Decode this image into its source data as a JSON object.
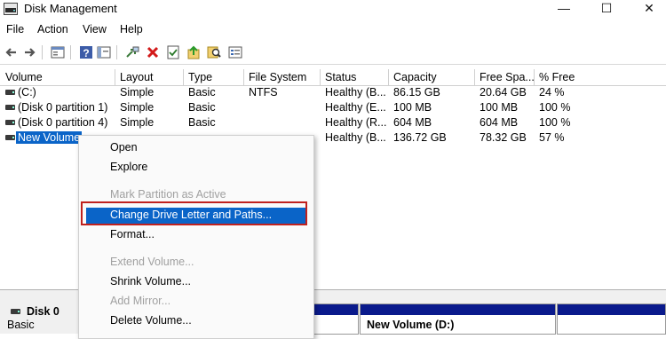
{
  "window": {
    "title": "Disk Management",
    "minimize": "—",
    "maximize": "☐",
    "close": "✕"
  },
  "menu": [
    "File",
    "Action",
    "View",
    "Help"
  ],
  "toolbar_icons": [
    "back-arrow-icon",
    "forward-arrow-icon",
    "properties-icon",
    "help-icon",
    "console-icon",
    "connect-icon",
    "delete-icon",
    "checkmark-icon",
    "up-arrow-icon",
    "search-icon",
    "list-icon"
  ],
  "columns": [
    "Volume",
    "Layout",
    "Type",
    "File System",
    "Status",
    "Capacity",
    "Free Spa...",
    "% Free"
  ],
  "rows": [
    [
      "(C:)",
      "Simple",
      "Basic",
      "NTFS",
      "Healthy (B...",
      "86.15 GB",
      "20.64 GB",
      "24 %"
    ],
    [
      "(Disk 0 partition 1)",
      "Simple",
      "Basic",
      "",
      "Healthy (E...",
      "100 MB",
      "100 MB",
      "100 %"
    ],
    [
      "(Disk 0 partition 4)",
      "Simple",
      "Basic",
      "",
      "Healthy (R...",
      "604 MB",
      "604 MB",
      "100 %"
    ],
    [
      "New Volume",
      "",
      "",
      "",
      "Healthy (B...",
      "136.72 GB",
      "78.32 GB",
      "57 %"
    ]
  ],
  "context_menu": {
    "items": [
      {
        "label": "Open",
        "disabled": false
      },
      {
        "label": "Explore",
        "disabled": false
      },
      {
        "label": "Mark Partition as Active",
        "disabled": true
      },
      {
        "label": "Change Drive Letter and Paths...",
        "disabled": false,
        "highlighted": true
      },
      {
        "label": "Format...",
        "disabled": false
      },
      {
        "label": "Extend Volume...",
        "disabled": true
      },
      {
        "label": "Shrink Volume...",
        "disabled": false
      },
      {
        "label": "Add Mirror...",
        "disabled": true
      },
      {
        "label": "Delete Volume...",
        "disabled": false
      }
    ]
  },
  "disk_panel": {
    "disk": "Disk 0",
    "type": "Basic",
    "volume_label": "New Volume  (D:)"
  },
  "colors": {
    "selection": "#0a64c8",
    "callout": "#c0211e",
    "volume_bar": "#0a1a8c"
  }
}
